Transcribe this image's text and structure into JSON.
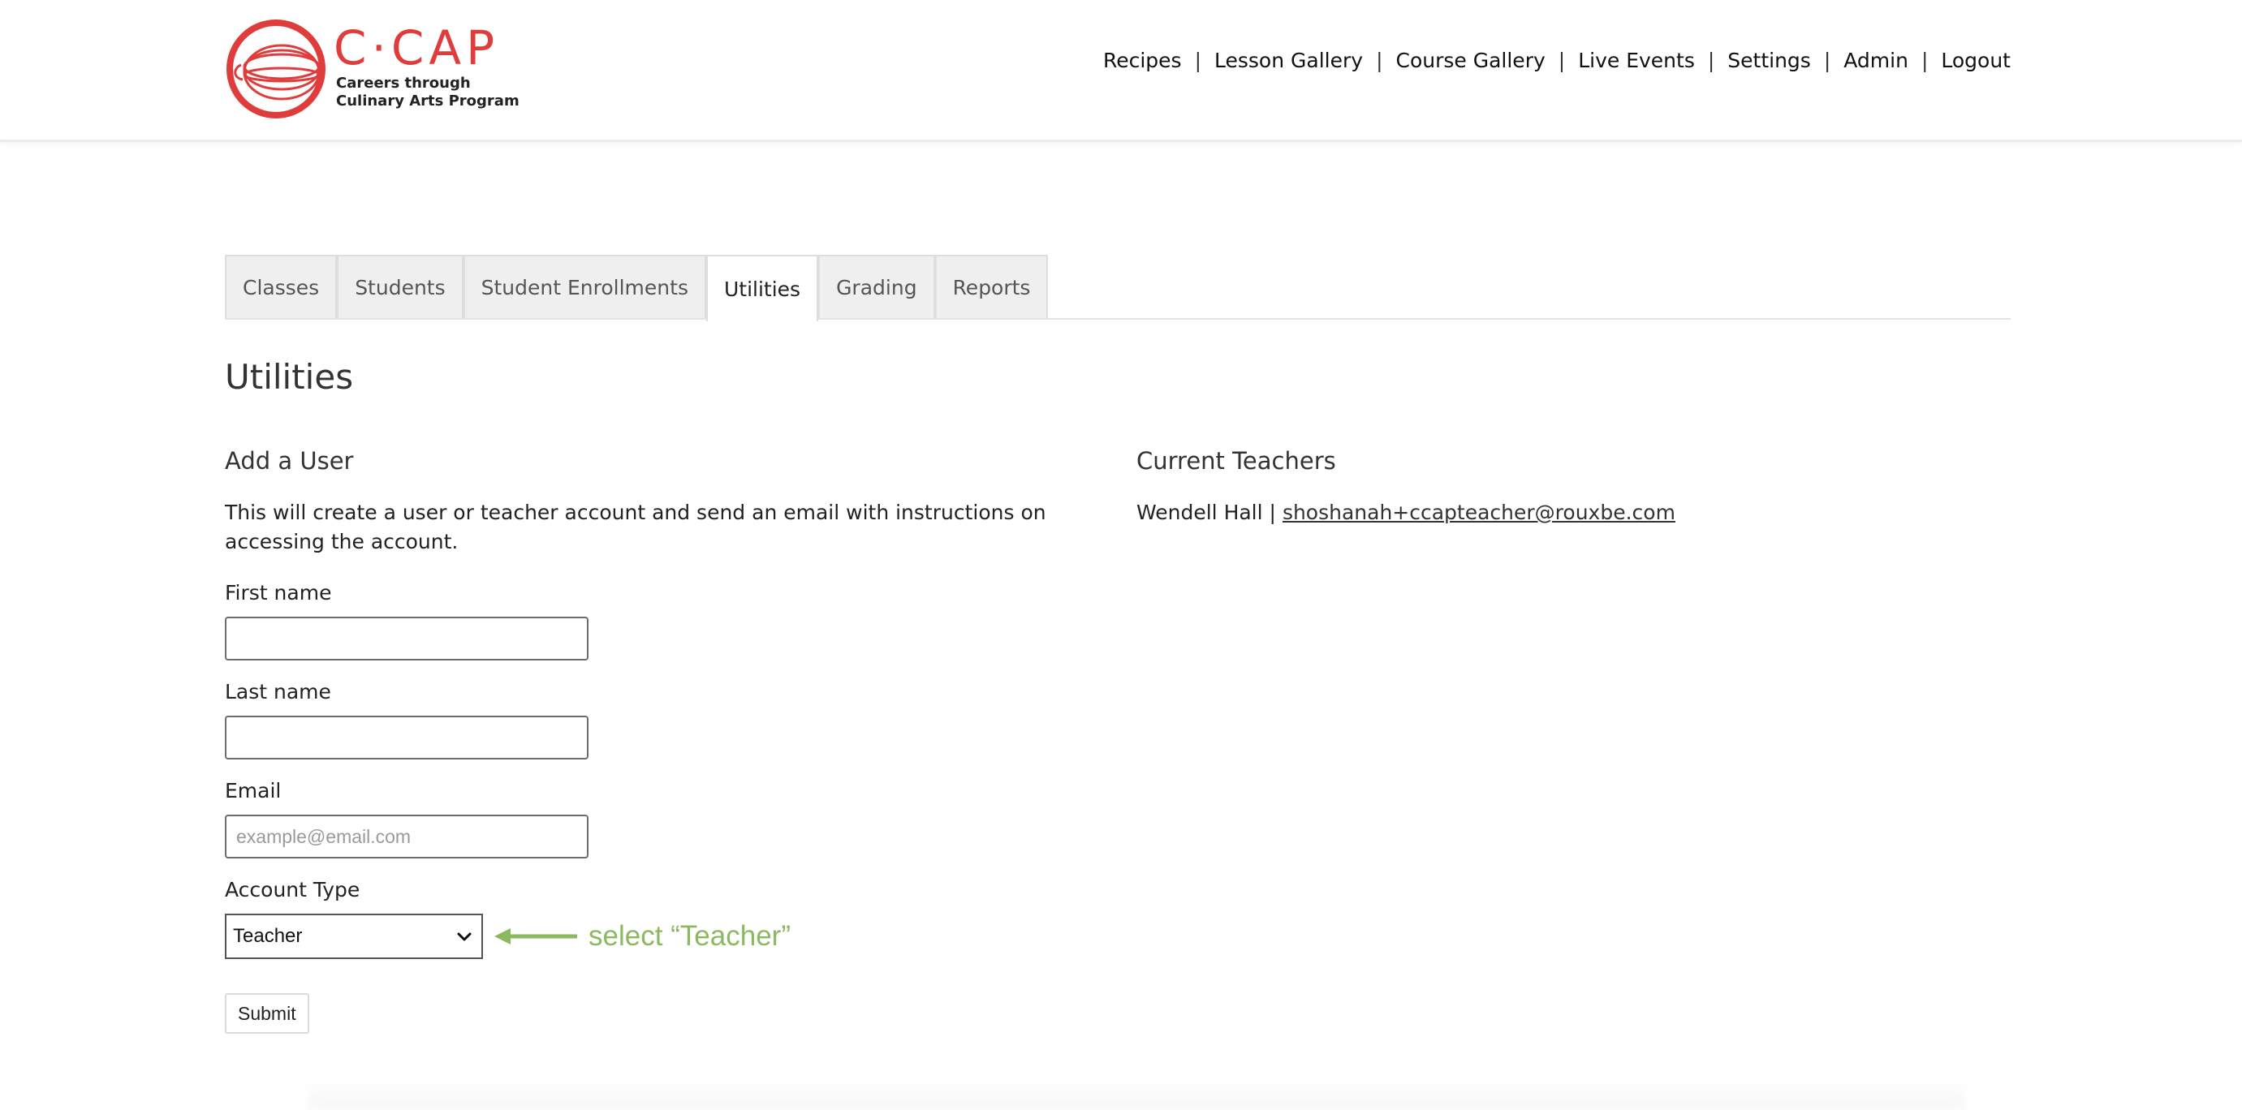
{
  "colors": {
    "brand_red": "#e03c3c",
    "annotation_green": "#8bb960"
  },
  "logo": {
    "word": "C·CAP",
    "subtitle_line1": "Careers through",
    "subtitle_line2": "Culinary Arts Program"
  },
  "topnav": {
    "items": [
      "Recipes",
      "Lesson Gallery",
      "Course Gallery",
      "Live Events",
      "Settings",
      "Admin",
      "Logout"
    ],
    "separator": "|"
  },
  "tabs": [
    {
      "label": "Classes",
      "active": false
    },
    {
      "label": "Students",
      "active": false
    },
    {
      "label": "Student Enrollments",
      "active": false
    },
    {
      "label": "Utilities",
      "active": true
    },
    {
      "label": "Grading",
      "active": false
    },
    {
      "label": "Reports",
      "active": false
    }
  ],
  "page_title": "Utilities",
  "add_user": {
    "title": "Add a User",
    "description": "This will create a user or teacher account and send an email with instructions on accessing the account.",
    "first_name_label": "First name",
    "first_name_value": "",
    "last_name_label": "Last name",
    "last_name_value": "",
    "email_label": "Email",
    "email_placeholder": "example@email.com",
    "account_type_label": "Account Type",
    "account_type_selected": "Teacher",
    "annotation": "select “Teacher”",
    "submit_label": "Submit"
  },
  "current_teachers": {
    "title": "Current Teachers",
    "teachers": [
      {
        "name": "Wendell Hall",
        "separator": "|",
        "email": "shoshanah+ccapteacher@rouxbe.com"
      }
    ]
  }
}
